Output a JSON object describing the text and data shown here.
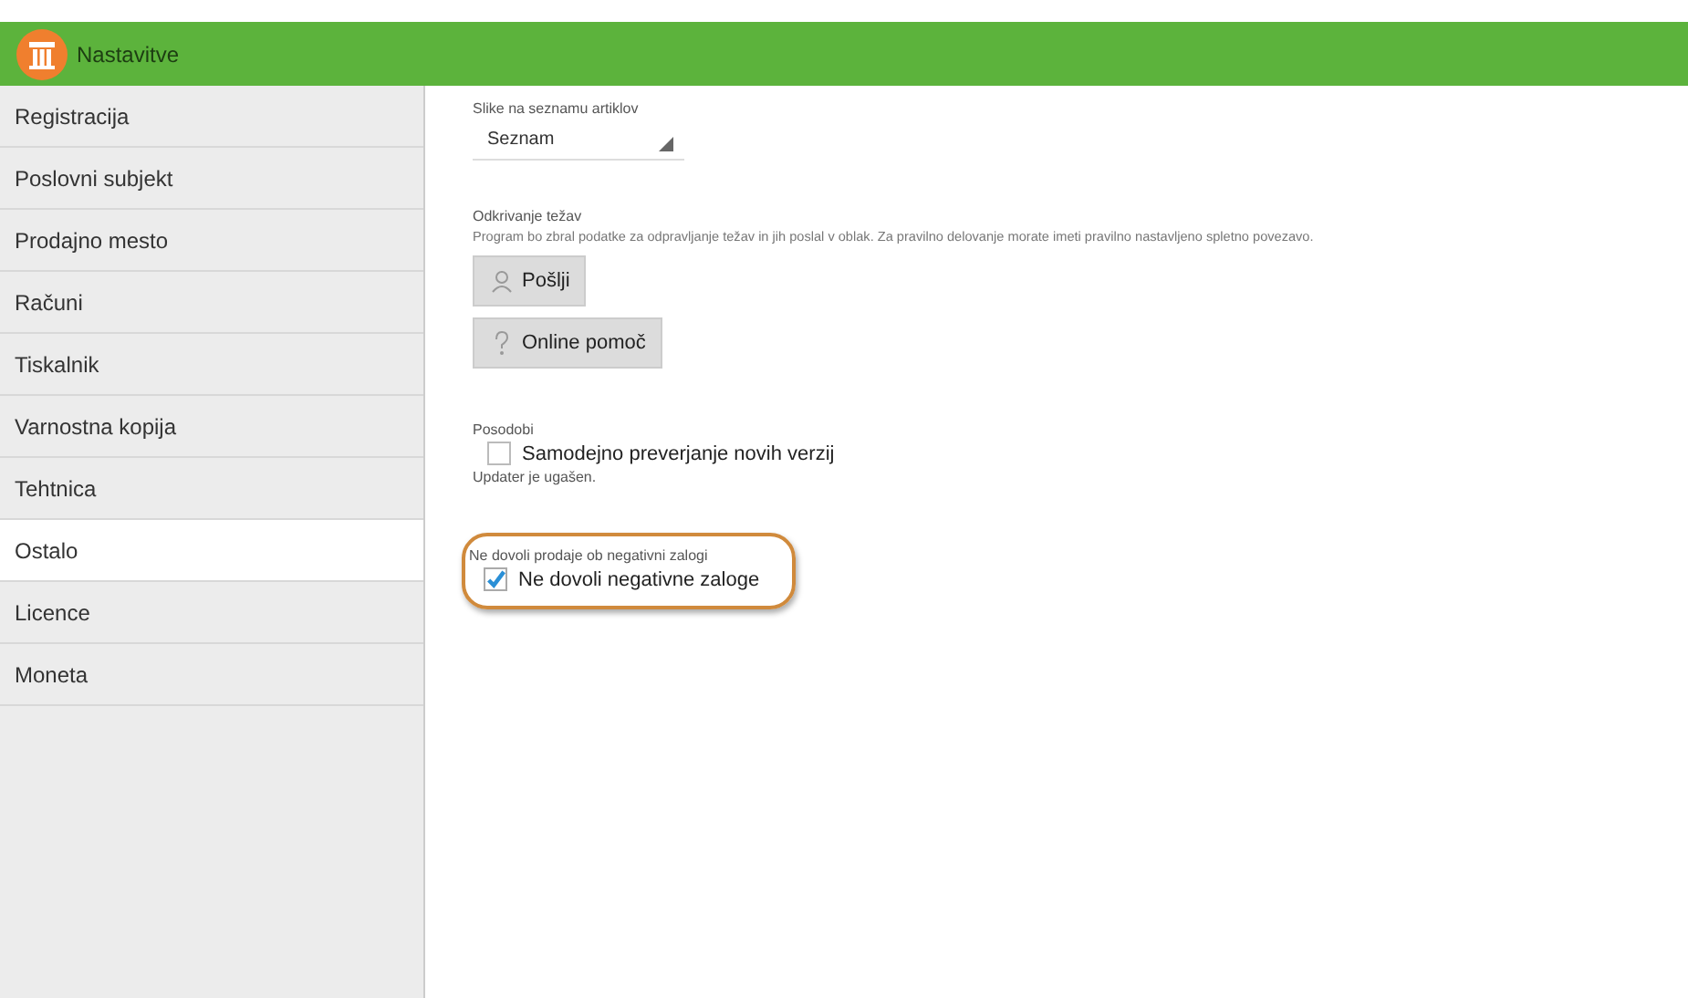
{
  "window": {
    "title": "Nastavitve"
  },
  "sidebar": {
    "items": [
      {
        "label": "Registracija",
        "selected": false
      },
      {
        "label": "Poslovni subjekt",
        "selected": false
      },
      {
        "label": "Prodajno mesto",
        "selected": false
      },
      {
        "label": "Računi",
        "selected": false
      },
      {
        "label": "Tiskalnik",
        "selected": false
      },
      {
        "label": "Varnostna kopija",
        "selected": false
      },
      {
        "label": "Tehtnica",
        "selected": false
      },
      {
        "label": "Ostalo",
        "selected": true
      },
      {
        "label": "Licence",
        "selected": false
      },
      {
        "label": "Moneta",
        "selected": false
      }
    ]
  },
  "sections": [
    {
      "kind": "dropdown",
      "title": "Slike na seznamu artiklov",
      "value": "Seznam"
    },
    {
      "kind": "buttons",
      "title": "Odkrivanje težav",
      "description": "Program bo zbral podatke za odpravljanje težav in jih poslal v oblak. Za pravilno delovanje morate imeti pravilno nastavljeno spletno povezavo.",
      "buttons": [
        {
          "label": "Pošlji"
        },
        {
          "label": "Online pomoč"
        }
      ]
    },
    {
      "kind": "checkbox",
      "title": "Posodobi",
      "label": "Samodejno preverjanje novih verzij",
      "checked": false,
      "note": "Updater je ugašen."
    },
    {
      "kind": "checkbox",
      "title": "Ne dovoli prodaje ob negativni zalogi",
      "label": "Ne dovoli negativne zaloge",
      "checked": true,
      "highlighted": true
    }
  ]
}
